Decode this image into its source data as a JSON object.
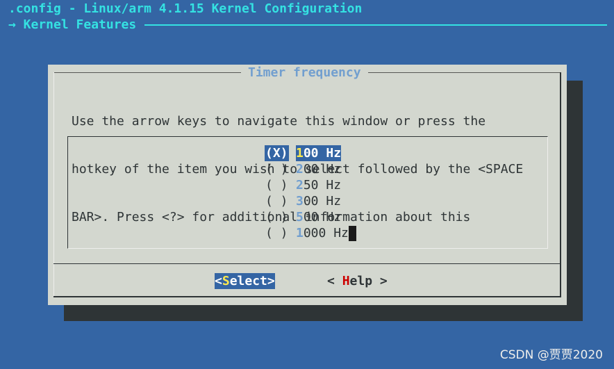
{
  "window": {
    "title": ".config - Linux/arm 4.1.15 Kernel Configuration",
    "breadcrumb": "→ Kernel Features"
  },
  "dialog": {
    "title": "Timer frequency",
    "instructions": [
      "Use the arrow keys to navigate this window or press the",
      "hotkey of the item you wish to select followed by the <SPACE",
      "BAR>. Press <?> for additional information about this"
    ],
    "options": [
      {
        "radio": "(X)",
        "hotkey": "1",
        "rest": "00 Hz",
        "selected": true
      },
      {
        "radio": "( )",
        "hotkey": "2",
        "rest": "00 Hz",
        "selected": false
      },
      {
        "radio": "( )",
        "hotkey": "2",
        "rest": "50 Hz",
        "selected": false
      },
      {
        "radio": "( )",
        "hotkey": "3",
        "rest": "00 Hz",
        "selected": false
      },
      {
        "radio": "( )",
        "hotkey": "5",
        "rest": "00 Hz",
        "selected": false
      },
      {
        "radio": "( )",
        "hotkey": "1",
        "rest": "000 Hz",
        "selected": false
      }
    ],
    "buttons": {
      "select": {
        "left": "<",
        "hotkey": "S",
        "rest": "elect>"
      },
      "help": {
        "left": "< ",
        "hotkey": "H",
        "rest": "elp >"
      }
    }
  },
  "watermark": "CSDN @贾贾2020",
  "colors": {
    "background": "#3465a4",
    "dialog": "#d3d7cf",
    "title_text": "#34e2e2",
    "hotkey": "#729fcf",
    "selected_hotkey": "#fce94f",
    "help_hotkey": "#cc0000"
  }
}
